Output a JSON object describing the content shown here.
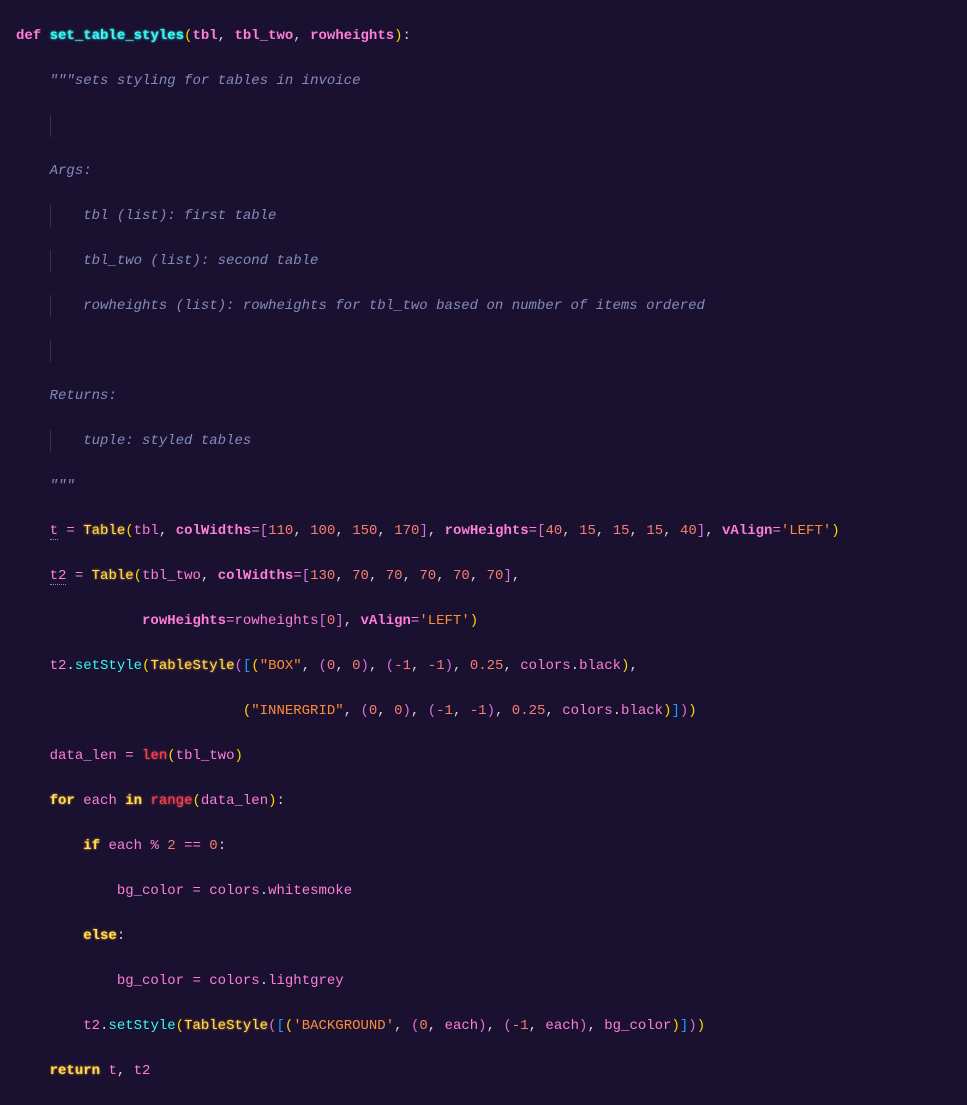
{
  "code": {
    "defKw": "def",
    "fnName": "set_table_styles",
    "params": {
      "p1": "tbl",
      "p2": "tbl_two",
      "p3": "rowheights"
    },
    "doc": {
      "q": "\"\"\"",
      "summary": "sets styling for tables in invoice",
      "argsHdr": "Args:",
      "arg1": "tbl (list): first table",
      "arg2": "tbl_two (list): second table",
      "arg3": "rowheights (list): rowheights for tbl_two based on number of items ordered",
      "retHdr": "Returns:",
      "ret1": "tuple: styled tables"
    },
    "tableCls": "Table",
    "tableStyleCls": "TableStyle",
    "t": "t",
    "t2": "t2",
    "eq": " = ",
    "colWidthsKw": "colWidths",
    "rowHeightsKw": "rowHeights",
    "vAlignKw": "vAlign",
    "leftStr": "'LEFT'",
    "boxStr": "\"BOX\"",
    "innergridStr": "\"INNERGRID\"",
    "bgStr": "'BACKGROUND'",
    "setStyle": "setStyle",
    "colors": "colors",
    "black": "black",
    "whitesmoke": "whitesmoke",
    "lightgrey": "lightgrey",
    "dataLen": "data_len",
    "len": "len",
    "forKw": "for",
    "inKw": "in",
    "range": "range",
    "each": "each",
    "ifKw": "if",
    "elseKw": "else",
    "returnKw": "return",
    "mod": " % ",
    "eqeq": " == ",
    "bgColor": "bg_color",
    "nums": {
      "cw1": [
        "110",
        "100",
        "150",
        "170"
      ],
      "rh1": [
        "40",
        "15",
        "15",
        "15",
        "40"
      ],
      "cw2": [
        "130",
        "70",
        "70",
        "70",
        "70",
        "70"
      ],
      "zero": "0",
      "nOne": "-1",
      "p25": "0.25",
      "two": "2"
    },
    "rowheightsIdx": "rowheights"
  }
}
